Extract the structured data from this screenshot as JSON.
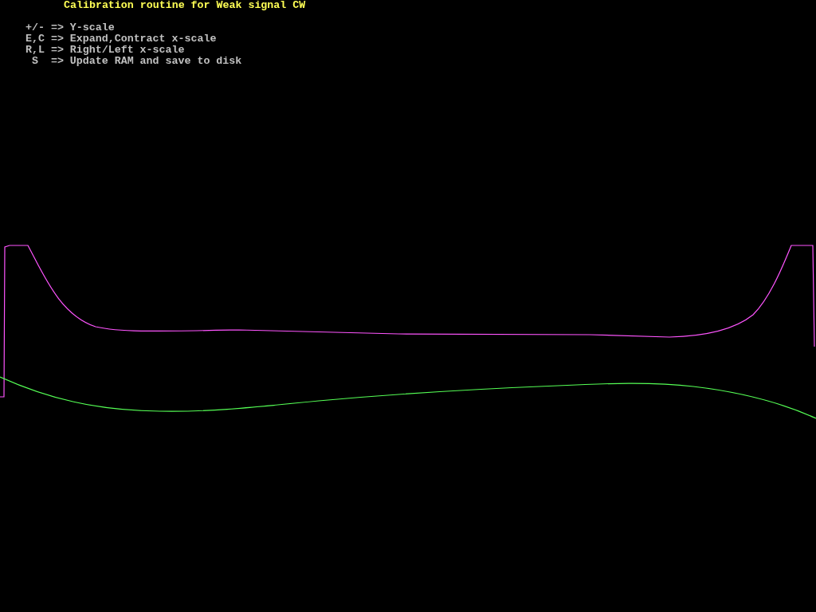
{
  "title": "Calibration routine for Weak signal CW",
  "help": [
    " +/- => Y-scale",
    " E,C => Expand,Contract x-scale",
    " R,L => Right/Left x-scale",
    "  S  => Update RAM and save to disk"
  ]
}
